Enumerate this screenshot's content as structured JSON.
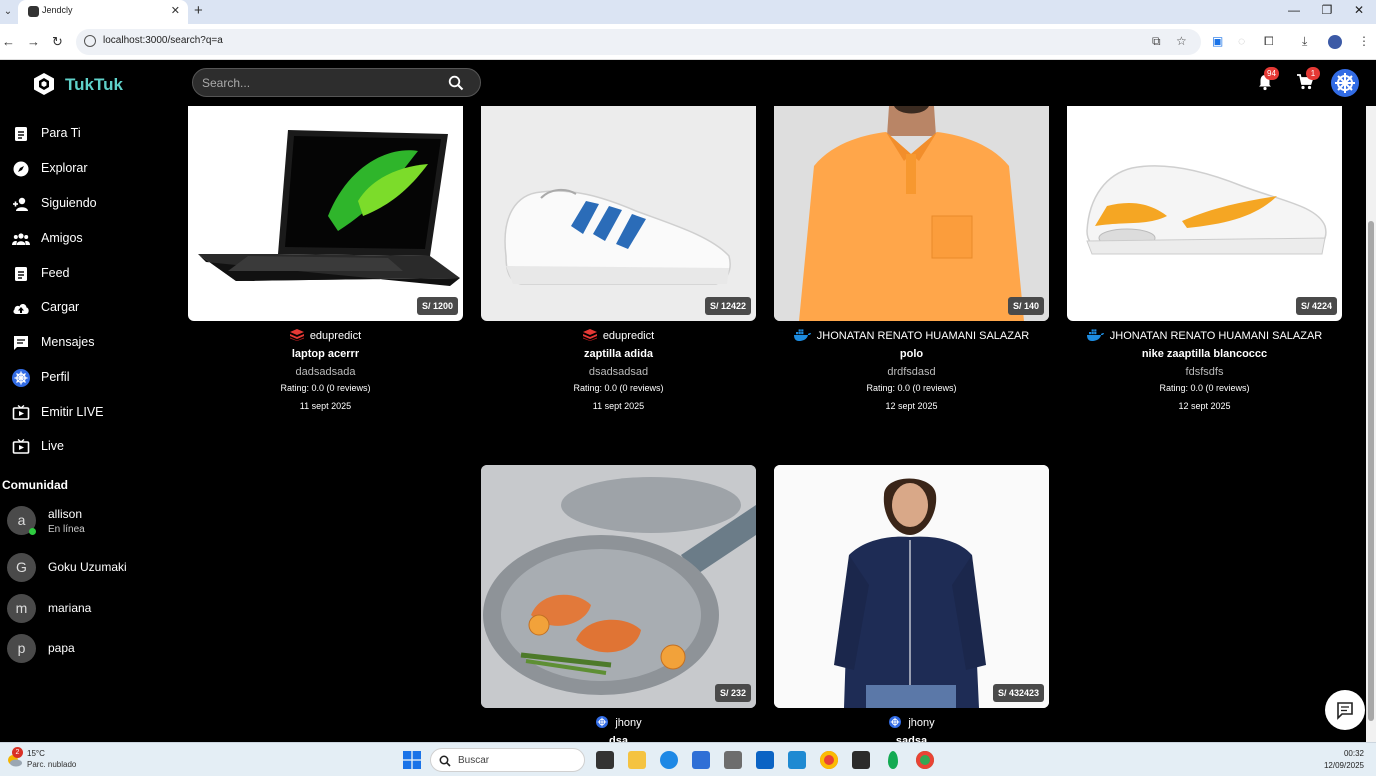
{
  "browser": {
    "tab_title": "Jendcly",
    "tab_close": "✕",
    "new_tab": "+",
    "url": "localhost:3000/search?q=a",
    "window_minimize": "—",
    "window_restore": "❐",
    "window_close": "✕"
  },
  "app": {
    "brand": "TukTuk",
    "search_placeholder": "Search...",
    "notifications_count": "94",
    "cart_count": "1"
  },
  "sidebar": {
    "items": [
      {
        "label": "Para Ti",
        "icon": "document-icon"
      },
      {
        "label": "Explorar",
        "icon": "compass-icon"
      },
      {
        "label": "Siguiendo",
        "icon": "person-add-icon"
      },
      {
        "label": "Amigos",
        "icon": "group-icon"
      },
      {
        "label": "Feed",
        "icon": "document-icon"
      },
      {
        "label": "Cargar",
        "icon": "cloud-upload-icon"
      },
      {
        "label": "Mensajes",
        "icon": "chat-icon"
      },
      {
        "label": "Perfil",
        "icon": "helm-avatar-icon"
      },
      {
        "label": "Emitir LIVE",
        "icon": "live-tv-icon"
      },
      {
        "label": "Live",
        "icon": "live-tv-icon"
      }
    ],
    "community_title": "Comunidad",
    "friends": [
      {
        "initial": "a",
        "name": "allison",
        "status": "En línea"
      },
      {
        "initial": "G",
        "name": "Goku Uzumaki",
        "status": ""
      },
      {
        "initial": "m",
        "name": "mariana",
        "status": ""
      },
      {
        "initial": "p",
        "name": "papa",
        "status": ""
      }
    ]
  },
  "products": [
    {
      "price": "S/ 1200",
      "seller": "edupredict",
      "name": "laptop acerrr",
      "desc": "dadsadsada",
      "rating": "Rating: 0.0 (0 reviews)",
      "date": "11 sept 2025"
    },
    {
      "price": "S/ 12422",
      "seller": "edupredict",
      "name": "zaptilla adida",
      "desc": "dsadsadsad",
      "rating": "Rating: 0.0 (0 reviews)",
      "date": "11 sept 2025"
    },
    {
      "price": "S/ 140",
      "seller": "JHONATAN RENATO HUAMANI SALAZAR",
      "name": "polo",
      "desc": "drdfsdasd",
      "rating": "Rating: 0.0 (0 reviews)",
      "date": "12 sept 2025"
    },
    {
      "price": "S/ 4224",
      "seller": "JHONATAN RENATO HUAMANI SALAZAR",
      "name": "nike zaaptilla blancoccc",
      "desc": "fdsfsdfs",
      "rating": "Rating: 0.0 (0 reviews)",
      "date": "12 sept 2025"
    },
    {
      "price": "S/ 232",
      "seller": "jhony",
      "name": "dsa",
      "desc": "",
      "rating": "",
      "date": ""
    },
    {
      "price": "S/ 432423",
      "seller": "jhony",
      "name": "sadsa",
      "desc": "",
      "rating": "",
      "date": ""
    }
  ],
  "taskbar": {
    "weather_badge": "2",
    "temperature": "15°C",
    "weather": "Parc. nublado",
    "search_label": "Buscar",
    "time": "00:32",
    "date": "12/09/2025"
  },
  "colors": {
    "brand": "#5fd1c9",
    "badge": "#e53935",
    "edupredict_logo": "#e53935",
    "docker_logo": "#1d8ce0",
    "helm_logo": "#326ce5"
  }
}
